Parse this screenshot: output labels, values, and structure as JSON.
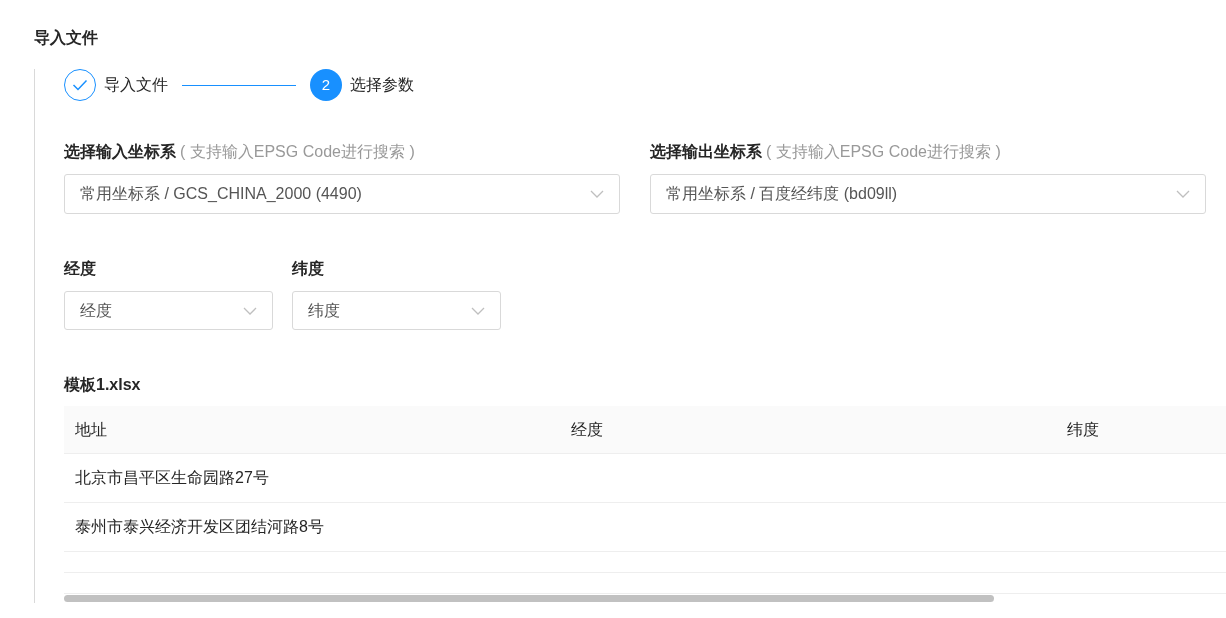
{
  "title": "导入文件",
  "steps": [
    {
      "completed": true,
      "label": "导入文件"
    },
    {
      "completed": false,
      "number": "2",
      "label": "选择参数"
    }
  ],
  "coordinate_selects": [
    {
      "label": "选择输入坐标系",
      "hint": "( 支持输入EPSG Code进行搜索 )",
      "value": "常用坐标系 / GCS_CHINA_2000 (4490)"
    },
    {
      "label": "选择输出坐标系",
      "hint": "( 支持输入EPSG Code进行搜索 )",
      "value": "常用坐标系 / 百度经纬度 (bd09ll)"
    }
  ],
  "column_selects": [
    {
      "label": "经度",
      "value": "经度"
    },
    {
      "label": "纬度",
      "value": "纬度"
    }
  ],
  "table": {
    "title": "模板1.xlsx",
    "columns": [
      "地址",
      "经度",
      "纬度"
    ],
    "rows": [
      [
        "北京市昌平区生命园路27号",
        "",
        ""
      ],
      [
        "泰州市泰兴经济开发区团结河路8号",
        "",
        ""
      ]
    ]
  }
}
